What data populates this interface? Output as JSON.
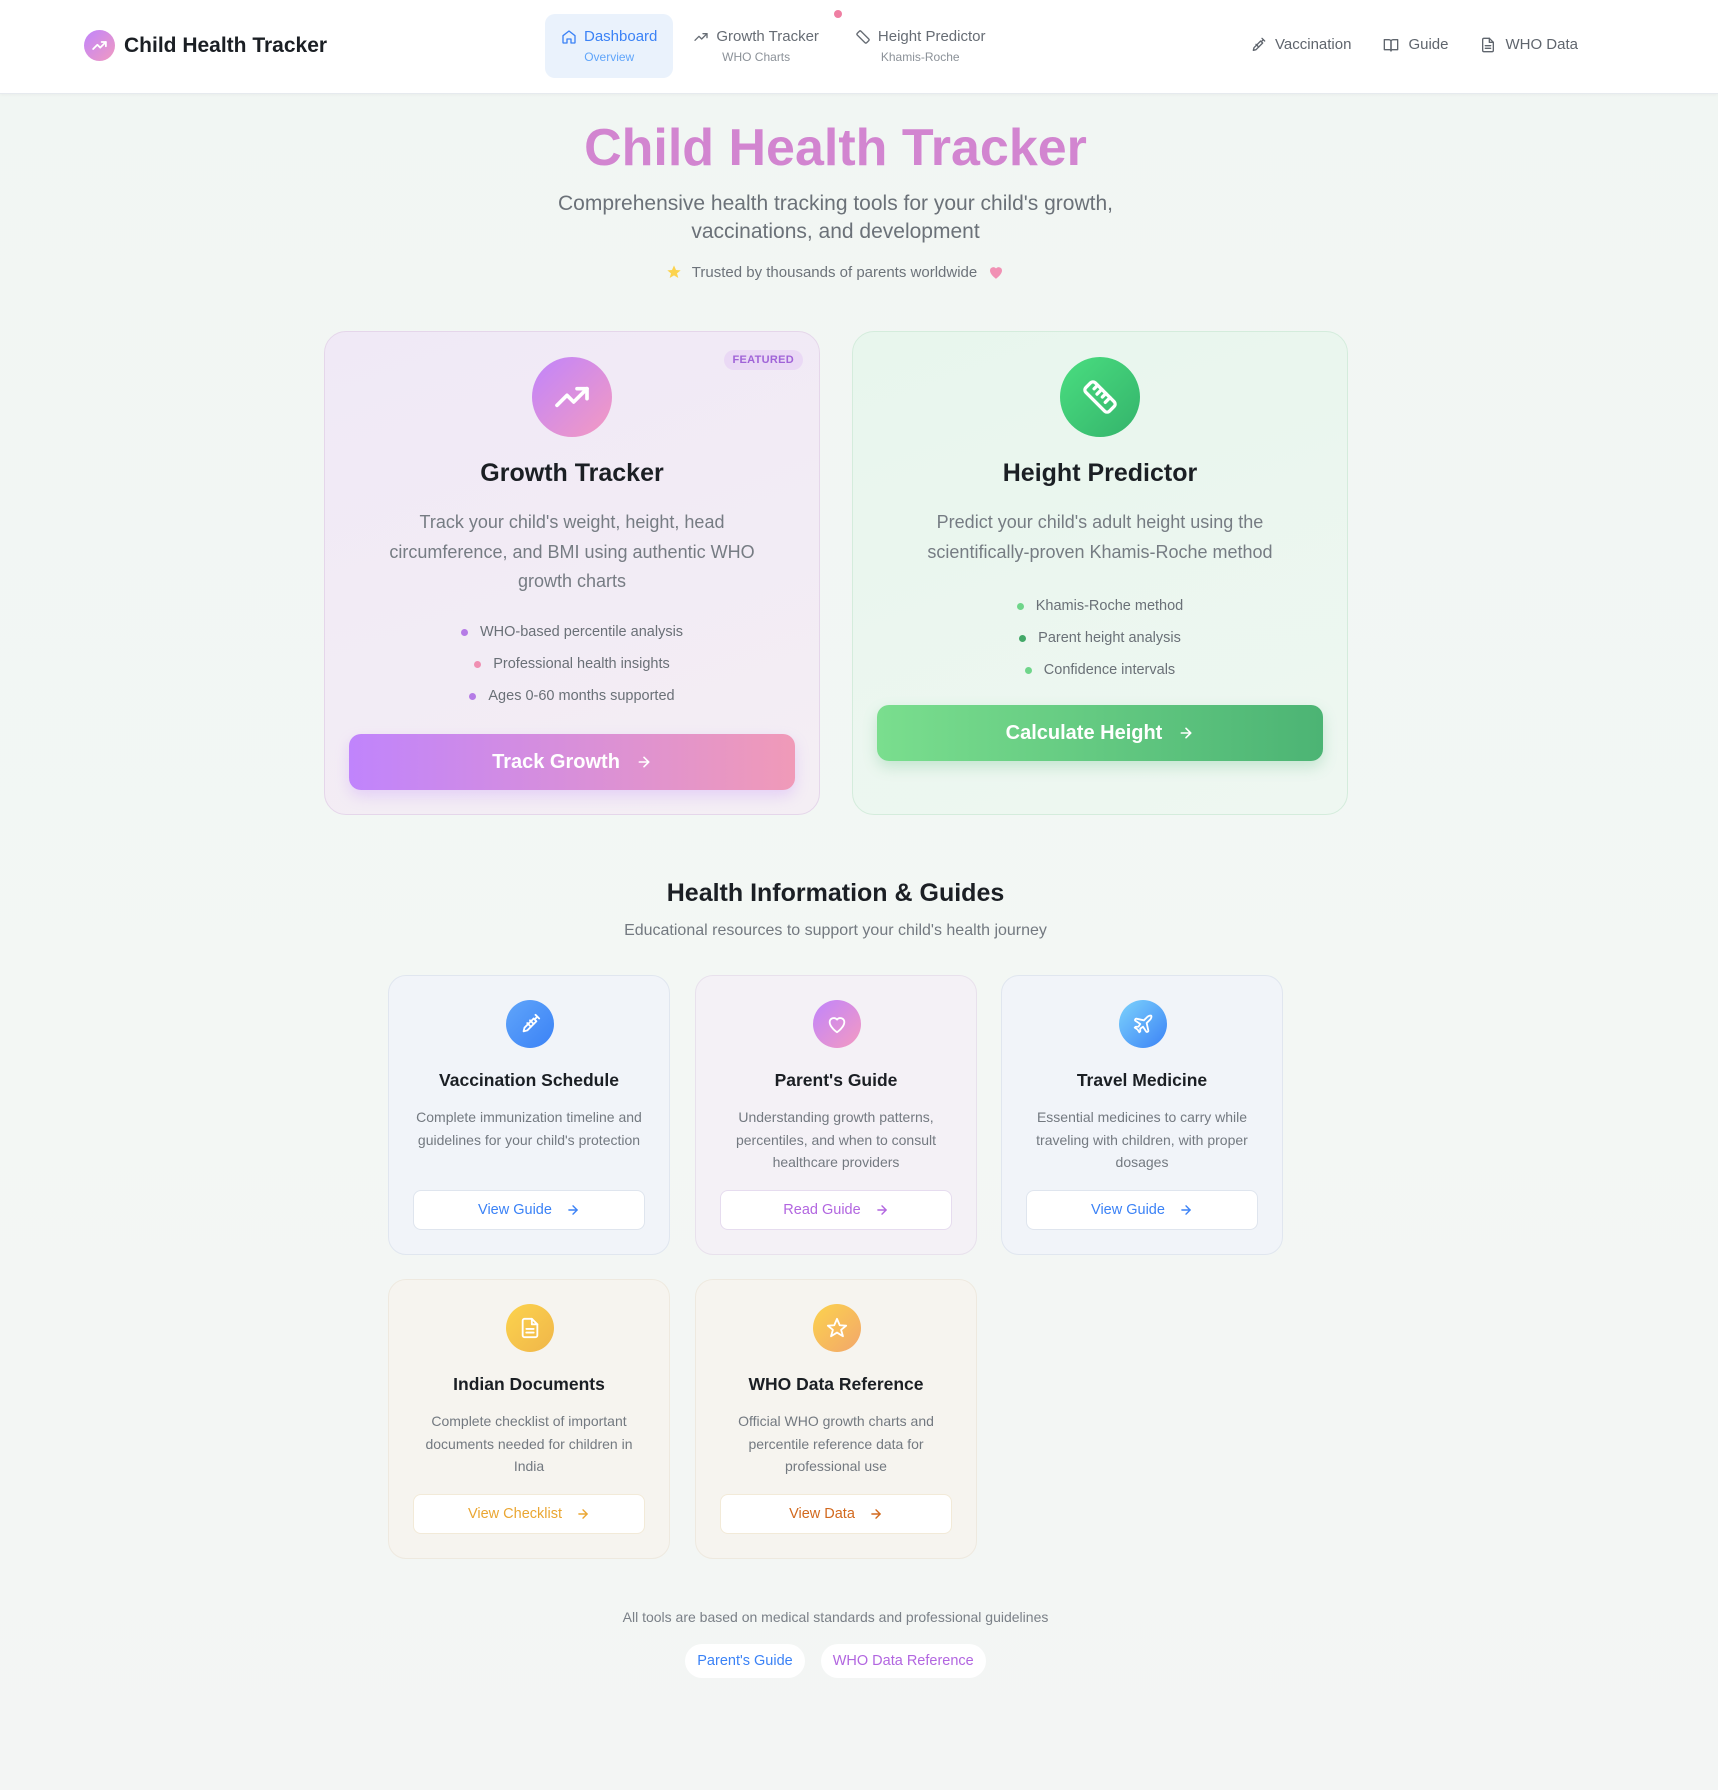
{
  "header": {
    "brand": "Child Health Tracker",
    "tabs": [
      {
        "label": "Dashboard",
        "sub": "Overview",
        "icon": "home-icon"
      },
      {
        "label": "Growth Tracker",
        "sub": "WHO Charts",
        "icon": "trending-up-icon"
      },
      {
        "label": "Height Predictor",
        "sub": "Khamis-Roche",
        "icon": "ruler-icon"
      }
    ],
    "links": [
      {
        "label": "Vaccination",
        "icon": "syringe-icon"
      },
      {
        "label": "Guide",
        "icon": "book-icon"
      },
      {
        "label": "WHO Data",
        "icon": "document-icon"
      }
    ]
  },
  "hero": {
    "title": "Child Health Tracker",
    "subtitle": "Comprehensive health tracking tools for your child's growth, vaccinations, and development",
    "trust": "Trusted by thousands of parents worldwide"
  },
  "features": {
    "growth": {
      "badge": "FEATURED",
      "title": "Growth Tracker",
      "description": "Track your child's weight, height, head circumference, and BMI using authentic WHO growth charts",
      "points": [
        "WHO-based percentile analysis",
        "Professional health insights",
        "Ages 0-60 months supported"
      ],
      "button": "Track Growth"
    },
    "height": {
      "title": "Height Predictor",
      "description": "Predict your child's adult height using the scientifically-proven Khamis-Roche method",
      "points": [
        "Khamis-Roche method",
        "Parent height analysis",
        "Confidence intervals"
      ],
      "button": "Calculate Height"
    }
  },
  "guides": {
    "title": "Health Information & Guides",
    "subtitle": "Educational resources to support your child's health journey",
    "cards": [
      {
        "title": "Vaccination Schedule",
        "description": "Complete immunization timeline and guidelines for your child's protection",
        "button": "View Guide",
        "icon": "syringe-icon"
      },
      {
        "title": "Parent's Guide",
        "description": "Understanding growth patterns, percentiles, and when to consult healthcare providers",
        "button": "Read Guide",
        "icon": "heart-icon"
      },
      {
        "title": "Travel Medicine",
        "description": "Essential medicines to carry while traveling with children, with proper dosages",
        "button": "View Guide",
        "icon": "plane-icon"
      },
      {
        "title": "Indian Documents",
        "description": "Complete checklist of important documents needed for children in India",
        "button": "View Checklist",
        "icon": "document-icon"
      },
      {
        "title": "WHO Data Reference",
        "description": "Official WHO growth charts and percentile reference data for professional use",
        "button": "View Data",
        "icon": "star-icon"
      }
    ]
  },
  "footer": {
    "note": "All tools are based on medical standards and professional guidelines",
    "links": [
      "Parent's Guide",
      "WHO Data Reference"
    ]
  },
  "colors": {
    "accent_blue": "#3b82f6",
    "accent_purple": "#c084fc",
    "accent_pink": "#f19ac0",
    "accent_green": "#4cb474",
    "accent_amber": "#f0b64a",
    "title_pink": "#d285d0"
  }
}
